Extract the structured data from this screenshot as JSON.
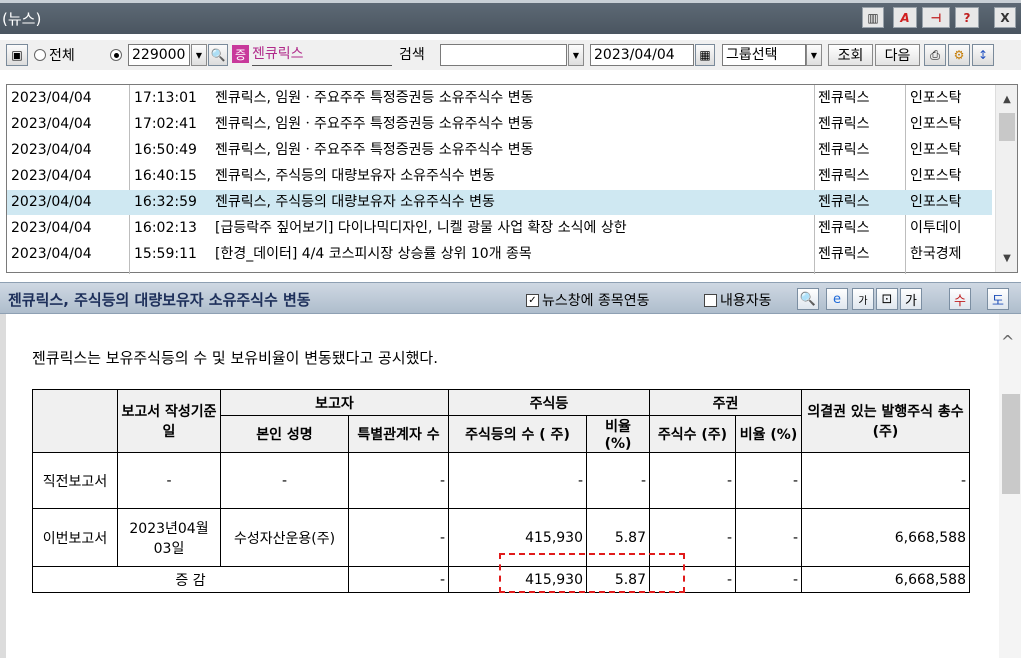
{
  "window": {
    "title": "(뉴스)",
    "buttons": [
      "A",
      "?",
      "X"
    ]
  },
  "toolbar": {
    "radio_all": "전체",
    "stock_code": "229000",
    "badge": "증",
    "stock_name": "젠큐릭스",
    "search_label": "검색",
    "search_value": "",
    "date": "2023/04/04",
    "group_select": "그룹선택",
    "lookup": "조회",
    "next": "다음"
  },
  "news": [
    {
      "date": "2023/04/04",
      "time": "17:13:01",
      "headline": "젠큐릭스, 임원ㆍ주요주주 특정증권등 소유주식수 변동",
      "stock": "젠큐릭스",
      "source": "인포스탁"
    },
    {
      "date": "2023/04/04",
      "time": "17:02:41",
      "headline": "젠큐릭스, 임원ㆍ주요주주 특정증권등 소유주식수 변동",
      "stock": "젠큐릭스",
      "source": "인포스탁"
    },
    {
      "date": "2023/04/04",
      "time": "16:50:49",
      "headline": "젠큐릭스, 임원ㆍ주요주주 특정증권등 소유주식수 변동",
      "stock": "젠큐릭스",
      "source": "인포스탁"
    },
    {
      "date": "2023/04/04",
      "time": "16:40:15",
      "headline": "젠큐릭스, 주식등의 대량보유자 소유주식수 변동",
      "stock": "젠큐릭스",
      "source": "인포스탁"
    },
    {
      "date": "2023/04/04",
      "time": "16:32:59",
      "headline": "젠큐릭스, 주식등의 대량보유자 소유주식수 변동",
      "stock": "젠큐릭스",
      "source": "인포스탁"
    },
    {
      "date": "2023/04/04",
      "time": "16:02:13",
      "headline": "[급등락주 짚어보기] 다이나믹디자인, 니켈 광물 사업 확장 소식에 상한",
      "stock": "젠큐릭스",
      "source": "이투데이"
    },
    {
      "date": "2023/04/04",
      "time": "15:59:11",
      "headline": "[한경_데이터] 4/4 코스피시장 상승률 상위 10개 종목",
      "stock": "젠큐릭스",
      "source": "한국경제"
    }
  ],
  "headbar": {
    "headline": "젠큐릭스, 주식등의 대량보유자 소유주식수 변동",
    "chk_link": "뉴스창에 종목연동",
    "chk_auto": "내용자동",
    "btn_labels": [
      "가",
      "가",
      "수",
      "도"
    ]
  },
  "article": {
    "summary": "젠큐릭스는 보유주식등의 수 및 보유비율이 변동됐다고 공시했다.",
    "table": {
      "h_report_date": "보고서 작성기준일",
      "h_reporter": "보고자",
      "h_name": "본인 성명",
      "h_special": "특별관계자 수",
      "h_stocks": "주식등",
      "h_stock_count": "주식등의 수 ( 주)",
      "h_ratio": "비율 (%)",
      "h_shares": "주권",
      "h_share_count": "주식수 (주)",
      "h_share_ratio": "비율 (%)",
      "h_voting": "의결권 있는 발행주식 총수(주)",
      "r1_label": "직전보고서",
      "r1_date": "-",
      "r1_name": "-",
      "r1_special": "-",
      "r1_count": "-",
      "r1_ratio": "-",
      "r1_sc": "-",
      "r1_sr": "-",
      "r1_voting": "-",
      "r2_label": "이번보고서",
      "r2_date": "2023년04월03일",
      "r2_name": "수성자산운용(주)",
      "r2_special": "-",
      "r2_count": "415,930",
      "r2_ratio": "5.87",
      "r2_sc": "-",
      "r2_sr": "-",
      "r2_voting": "6,668,588",
      "r3_label": "증       감",
      "r3_special": "-",
      "r3_count": "415,930",
      "r3_ratio": "5.87",
      "r3_sc": "-",
      "r3_sr": "-",
      "r3_voting": "6,668,588"
    }
  }
}
